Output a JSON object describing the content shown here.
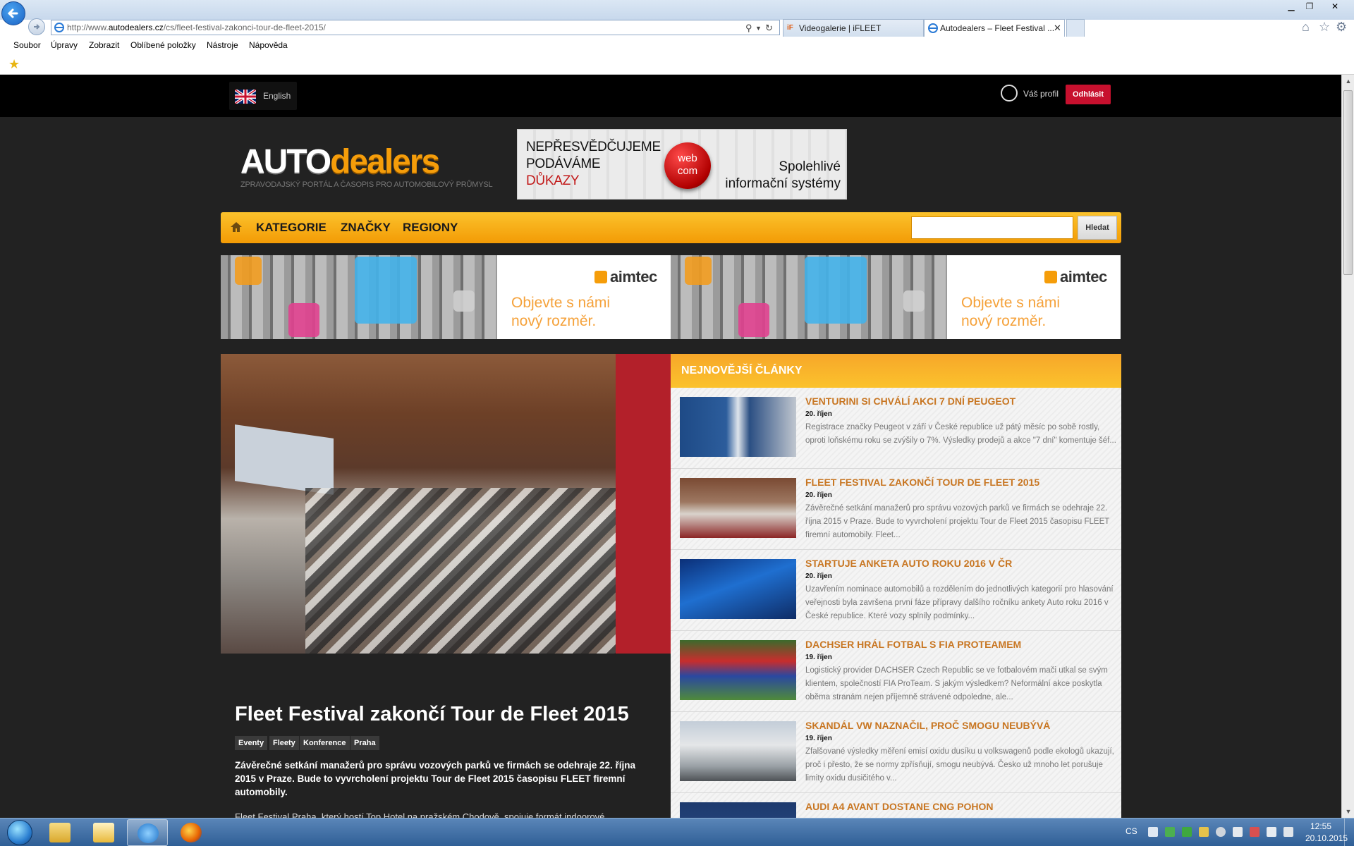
{
  "browser": {
    "url_prefix": "http://www.",
    "url_domain": "autodealers.cz",
    "url_path": "/cs/fleet-festival-zakonci-tour-de-fleet-2015/",
    "tabs": [
      {
        "label": "Videogalerie | iFLEET",
        "favicon": "iF"
      },
      {
        "label": "Autodealers – Fleet Festival ..."
      }
    ],
    "menu": [
      "Soubor",
      "Úpravy",
      "Zobrazit",
      "Oblíbené položky",
      "Nástroje",
      "Nápověda"
    ]
  },
  "topbar": {
    "language": "English",
    "profile": "Váš profil",
    "logout": "Odhlásit"
  },
  "logo": {
    "auto": "AUTO",
    "dealers": "dealers",
    "tagline": "ZPRAVODAJSKÝ PORTÁL A ČASOPIS PRO AUTOMOBILOVÝ PRŮMYSL"
  },
  "ad_webcom": {
    "line1": "NEPŘESVĚDČUJEME",
    "line2": "PODÁVÁME",
    "line3": "DŮKAZY",
    "brand1": "web",
    "brand2": "com",
    "tag1": "Spolehlivé",
    "tag2": "informační systémy"
  },
  "nav": {
    "items": [
      "KATEGORIE",
      "ZNAČKY",
      "REGIONY"
    ],
    "search_button": "Hledat",
    "search_value": ""
  },
  "ad_aimtec": {
    "brand": "aimtec",
    "slogan1": "Objevte s námi",
    "slogan2": "nový rozměr."
  },
  "article": {
    "title": "Fleet Festival zakončí Tour de Fleet 2015",
    "tags": [
      "Eventy",
      "Fleety",
      "Konference",
      "Praha"
    ],
    "lead": "Závěrečné setkání manažerů pro správu vozových parků ve firmách se odehraje 22. října 2015 v Praze. Bude to vyvrcholení projektu Tour de Fleet 2015 časopisu FLEET firemní automobily.",
    "body": "Fleet Festival Praha, který hostí Top Hotel na pražském Chodově, spojuje formát indoorové"
  },
  "sidebar": {
    "title": "NEJNOVĚJŠÍ ČLÁNKY",
    "items": [
      {
        "title": "VENTURINI SI CHVÁLÍ AKCI 7 DNÍ PEUGEOT",
        "date": "20. říjen",
        "excerpt": "Registrace značky Peugeot v září v České republice už pátý měsíc po sobě rostly, oproti loňskému roku se zvýšily o 7%. Výsledky prodejů a akce \"7 dní\" komentuje šéf..."
      },
      {
        "title": "FLEET FESTIVAL ZAKONČÍ TOUR DE FLEET 2015",
        "date": "20. říjen",
        "excerpt": "Závěrečné setkání manažerů pro správu vozových parků ve firmách se odehraje 22. října 2015 v Praze. Bude to vyvrcholení projektu Tour de Fleet 2015 časopisu FLEET firemní automobily. Fleet..."
      },
      {
        "title": "STARTUJE ANKETA AUTO ROKU 2016 V ČR",
        "date": "20. říjen",
        "excerpt": "Uzavřením nominace automobilů a rozdělením do jednotlivých kategorií pro hlasování veřejnosti byla završena první fáze přípravy dalšího ročníku ankety Auto roku 2016 v České republice. Které vozy splnily podmínky..."
      },
      {
        "title": "DACHSER HRÁL FOTBAL S FIA PROTEAMEM",
        "date": "19. říjen",
        "excerpt": "Logistický provider DACHSER Czech Republic se ve fotbalovém mači utkal se svým klientem, společností FIA ProTeam. S jakým výsledkem? Neformální akce poskytla oběma stranám nejen příjemně strávené odpoledne, ale..."
      },
      {
        "title": "SKANDÁL VW NAZNAČIL, PROČ SMOGU NEUBÝVÁ",
        "date": "19. říjen",
        "excerpt": "Zfalšované výsledky měření emisí oxidu dusíku u volkswagenů podle ekologů ukazují, proč i přesto, že se normy zpřísňují, smogu neubývá. Česko už mnoho let porušuje limity oxidu dusičitého v..."
      },
      {
        "title": "AUDI A4 AVANT DOSTANE CNG POHON",
        "date": "",
        "excerpt": ""
      }
    ]
  },
  "taskbar": {
    "lang": "CS",
    "time": "12:55",
    "date": "20.10.2015"
  },
  "colors": {
    "accent_orange": "#f39b05",
    "logout_red": "#c7102e",
    "news_title": "#c87622"
  }
}
